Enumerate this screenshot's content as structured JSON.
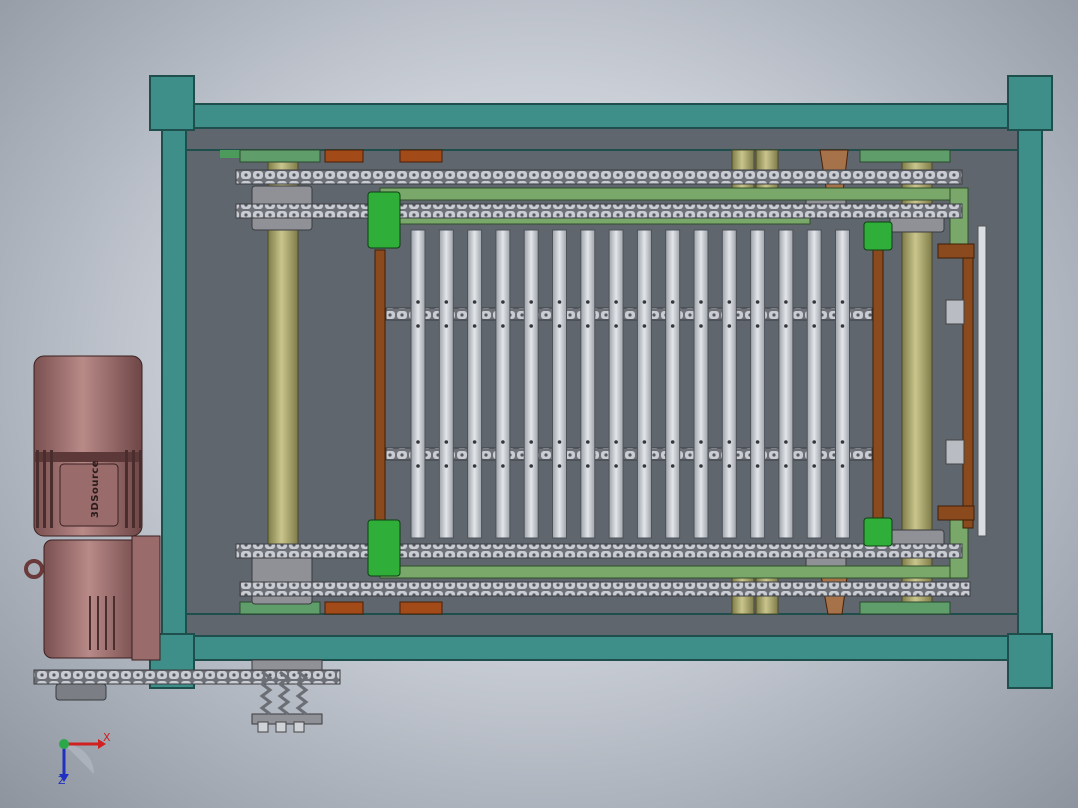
{
  "view": {
    "background_colors": [
      "#e6e9ee",
      "#9da4ae"
    ],
    "frame_color": "#3e8f8a",
    "frame_edge_color": "#1f4f4c",
    "shaft_color": "#a8a46a",
    "bracket_color": "#8a4a1e",
    "guide_color": "#7aa86a",
    "block_color": "#2fae3a",
    "slat_color": "#c4c8ce",
    "motor_color": "#9b6a6a",
    "chain_color": "#b9bcc2"
  },
  "motor": {
    "brand_text": "3DSource",
    "icon": "gear-motor-icon"
  },
  "triad": {
    "x_label": "X",
    "z_label": "Z",
    "icon": "coordinate-triad-icon"
  }
}
